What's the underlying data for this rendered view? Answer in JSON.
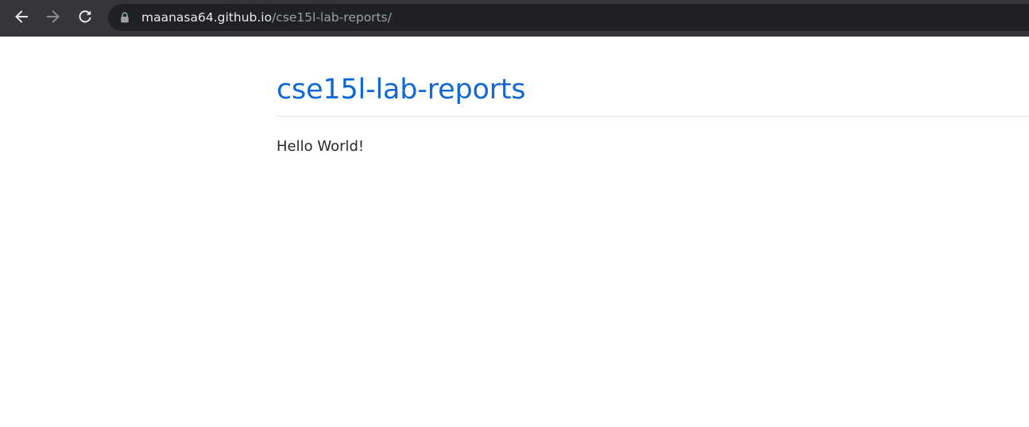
{
  "browser": {
    "back_icon": "arrow-left-icon",
    "forward_icon": "arrow-right-icon",
    "reload_icon": "reload-icon",
    "lock_icon": "lock-icon",
    "url_host": "maanasa64.github.io",
    "url_path": "/cse15l-lab-reports/",
    "colors": {
      "toolbar": "#35363a",
      "omnibox": "#202124"
    }
  },
  "page": {
    "title": "cse15l-lab-reports",
    "body": "Hello World!",
    "colors": {
      "title": "#1268d3",
      "text": "#24292e",
      "rule": "#e1e4e8"
    }
  }
}
